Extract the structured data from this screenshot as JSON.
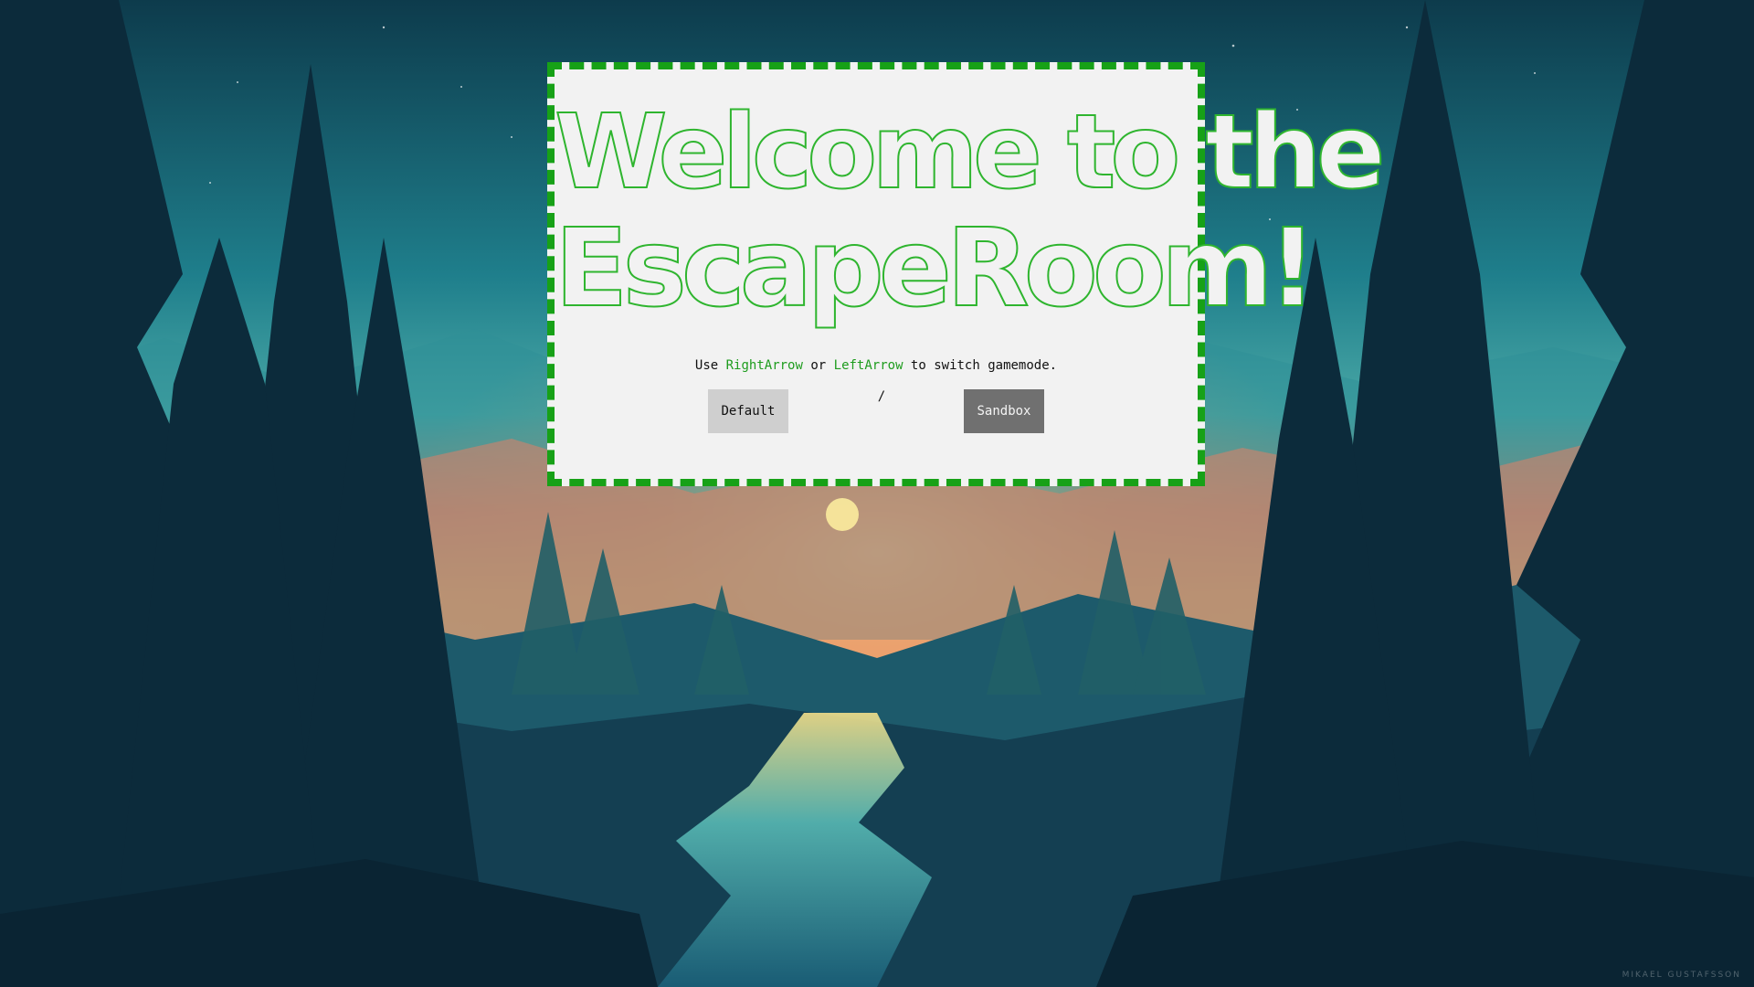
{
  "title": {
    "line1": "Welcome to the",
    "line2": "EscapeRoom!"
  },
  "hint": {
    "prefix": "Use ",
    "key_right": "RightArrow",
    "middle": " or ",
    "key_left": "LeftArrow",
    "suffix": " to switch gamemode."
  },
  "modes": {
    "default_label": "Default",
    "separator": "/",
    "sandbox_label": "Sandbox",
    "selected": "Sandbox"
  },
  "credit": "MIKAEL GUSTAFSSON",
  "colors": {
    "accent_green": "#17a117",
    "card_bg": "#f2f2f2",
    "selected_button": "#707070",
    "unselected_button": "#cfcfcf"
  }
}
